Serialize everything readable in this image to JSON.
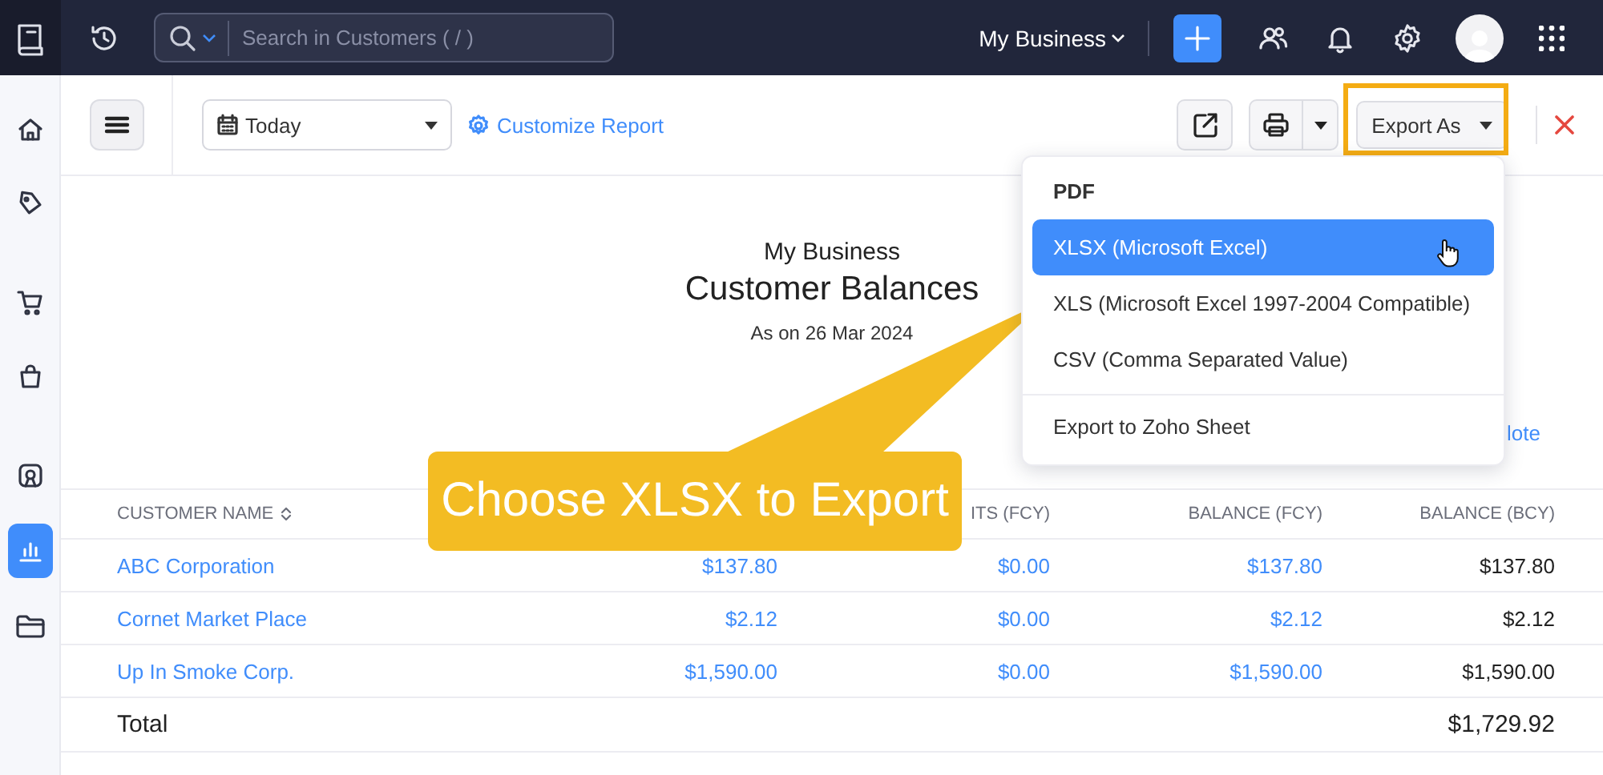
{
  "top_bar": {
    "search": {
      "placeholder": "Search in Customers ( / )"
    },
    "organization": "My Business"
  },
  "sidebar": {
    "items": [
      {
        "selected": false
      },
      {
        "selected": false
      },
      {
        "selected": false
      },
      {
        "selected": false
      },
      {
        "selected": false
      },
      {
        "selected": true
      },
      {
        "selected": false
      }
    ]
  },
  "toolbar": {
    "date_range": "Today",
    "customize_link": "Customize Report",
    "export_button": "Export As"
  },
  "export_menu": {
    "groups": [
      [
        {
          "label": "PDF",
          "selected": false
        },
        {
          "label": "XLSX (Microsoft Excel)",
          "selected": true
        },
        {
          "label": "XLS (Microsoft Excel 1997-2004 Compatible)",
          "selected": false
        },
        {
          "label": "CSV (Comma Separated Value)",
          "selected": false
        }
      ],
      [
        {
          "label": "Export to Zoho Sheet",
          "selected": false
        }
      ]
    ]
  },
  "report": {
    "organization": "My Business",
    "title": "Customer Balances",
    "date": "As on 26 Mar 2024",
    "link": "lote"
  },
  "table": {
    "columns": [
      "CUSTOMER NAME",
      "",
      "ITS (FCY)",
      "BALANCE (FCY)",
      "BALANCE (BCY)"
    ],
    "rows": [
      {
        "cells": [
          "ABC Corporation",
          "$137.80",
          "$0.00",
          "$137.80",
          "$137.80"
        ]
      },
      {
        "cells": [
          "Cornet Market Place",
          "$2.12",
          "$0.00",
          "$2.12",
          "$2.12"
        ]
      },
      {
        "cells": [
          "Up In Smoke Corp.",
          "$1,590.00",
          "$0.00",
          "$1,590.00",
          "$1,590.00"
        ]
      }
    ],
    "total": {
      "label": "Total",
      "amount": "$1,729.92"
    }
  },
  "callout": {
    "text": "Choose XLSX to Export"
  }
}
